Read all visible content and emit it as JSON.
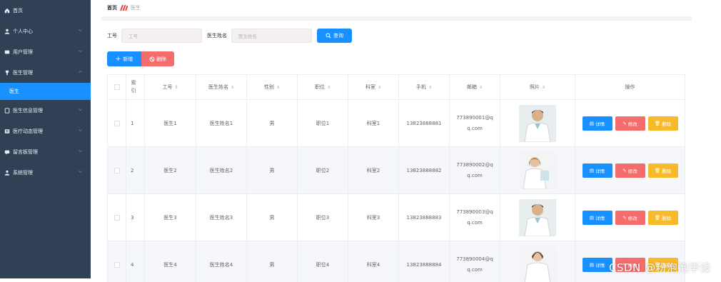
{
  "sidebar": {
    "items": [
      {
        "label": "首页",
        "icon": "home-icon",
        "has_chevron": false
      },
      {
        "label": "个人中心",
        "icon": "user-icon",
        "has_chevron": true
      },
      {
        "label": "用户管理",
        "icon": "users-icon",
        "has_chevron": true
      },
      {
        "label": "医生管理",
        "icon": "doctor-icon",
        "has_chevron": true,
        "expanded": true
      },
      {
        "label": "医生",
        "submenu": true,
        "active": true
      },
      {
        "label": "医生信息管理",
        "icon": "document-icon",
        "has_chevron": true
      },
      {
        "label": "医疗动态管理",
        "icon": "news-icon",
        "has_chevron": true
      },
      {
        "label": "留言板管理",
        "icon": "message-icon",
        "has_chevron": true
      },
      {
        "label": "系统管理",
        "icon": "settings-icon",
        "has_chevron": true
      }
    ]
  },
  "breadcrumb": {
    "home": "首页",
    "current": "医生"
  },
  "search": {
    "no_label": "工号",
    "no_placeholder": "工号",
    "name_label": "医生姓名",
    "name_placeholder": "医生姓名",
    "button": "查询"
  },
  "actions": {
    "add": "新增",
    "delete": "删除"
  },
  "table": {
    "headers": {
      "index": "索引",
      "no": "工号",
      "name": "医生姓名",
      "sex": "性别",
      "position": "职位",
      "dept": "科室",
      "phone": "手机",
      "email": "邮箱",
      "photo": "照片",
      "op": "操作"
    },
    "rows": [
      {
        "index": "1",
        "no": "医生1",
        "name": "医生姓名1",
        "sex": "男",
        "position": "职位1",
        "dept": "科室1",
        "phone": "13823888881",
        "email": "773890001@qq.com"
      },
      {
        "index": "2",
        "no": "医生2",
        "name": "医生姓名2",
        "sex": "男",
        "position": "职位2",
        "dept": "科室2",
        "phone": "13823888882",
        "email": "773890002@qq.com"
      },
      {
        "index": "3",
        "no": "医生3",
        "name": "医生姓名3",
        "sex": "男",
        "position": "职位3",
        "dept": "科室3",
        "phone": "13823888883",
        "email": "773890003@qq.com"
      },
      {
        "index": "4",
        "no": "医生4",
        "name": "医生姓名4",
        "sex": "男",
        "position": "职位4",
        "dept": "科室4",
        "phone": "13823888884",
        "email": "773890004@qq.com"
      }
    ],
    "row_actions": {
      "detail": "详情",
      "edit": "修改",
      "delete": "删除"
    }
  },
  "watermark": "CSDN @粉泡泡毕设",
  "colors": {
    "sidebar": "#304156",
    "primary": "#1890ff",
    "danger": "#f56c6c",
    "warning": "#f7ba2a"
  }
}
